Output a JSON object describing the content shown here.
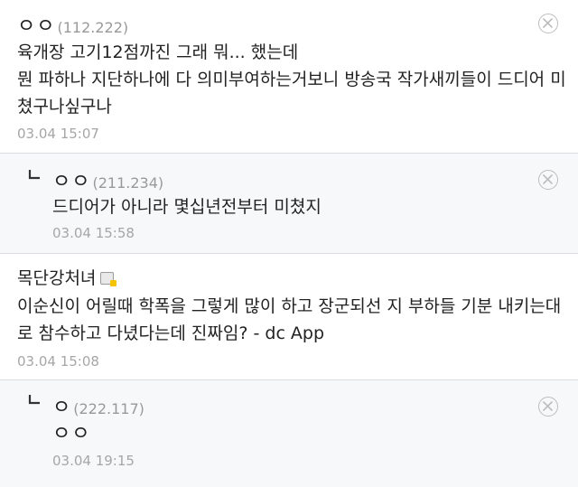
{
  "comments": [
    {
      "nick": "ㅇㅇ",
      "ip": "(112.222)",
      "lines": [
        "육개장 고기12점까진 그래 뭐... 했는데",
        "뭔 파하나 지단하나에 다 의미부여하는거보니 방송국 작가새끼들이 드디어 미",
        "쳤구나싶구나"
      ],
      "time": "03.04 15:07"
    },
    {
      "nick": "ㅇㅇ",
      "ip": "(211.234)",
      "lines": [
        "드디어가 아니라 몇십년전부터 미쳤지"
      ],
      "time": "03.04 15:58"
    },
    {
      "nick": "목단강처녀",
      "lines": [
        "이순신이 어릴때 학폭을 그렇게 많이 하고 장군되선 지 부하들 기분 내키는대",
        "로 참수하고 다녔다는데 진짜임? - dc App"
      ],
      "time": "03.04 15:08"
    },
    {
      "nick": "ㅇ",
      "ip": "(222.117)",
      "lines": [
        "ㅇㅇ"
      ],
      "time": "03.04 19:15"
    }
  ],
  "icons": {
    "delete": "close-circle-icon",
    "reply": "reply-arrow-icon",
    "member": "member-badge-icon"
  },
  "colors": {
    "reply_bg": "#f7f8fa",
    "timestamp": "#a6a6a6",
    "ip": "#999999",
    "badge_accent": "#f5c400"
  }
}
